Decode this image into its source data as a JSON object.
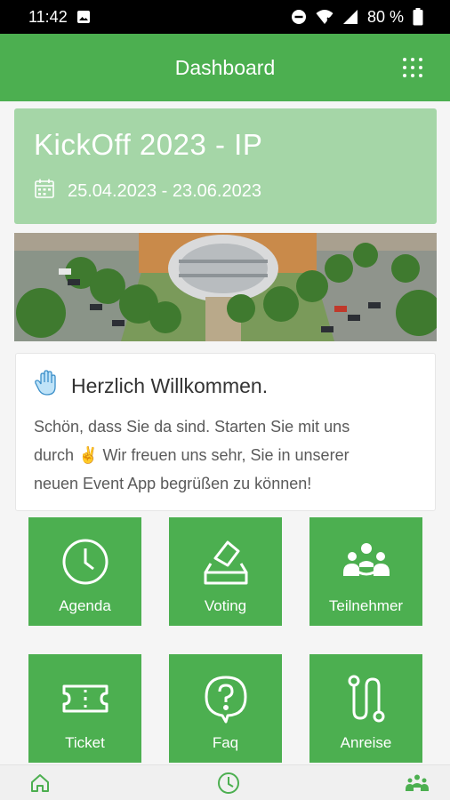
{
  "status_bar": {
    "time": "11:42",
    "battery": "80 %"
  },
  "app_bar": {
    "title": "Dashboard"
  },
  "event": {
    "name": "KickOff 2023 - IP",
    "dates": "25.04.2023 - 23.06.2023"
  },
  "welcome": {
    "title": "Herzlich Willkommen.",
    "line1": "Schön, dass Sie da sind. Starten Sie mit uns",
    "line2": "durch ✌ Wir freuen uns sehr, Sie in unserer",
    "line3": "neuen Event App begrüßen zu können!"
  },
  "tiles": [
    {
      "label": "Agenda",
      "icon": "clock-icon"
    },
    {
      "label": "Voting",
      "icon": "ballot-icon"
    },
    {
      "label": "Teilnehmer",
      "icon": "people-icon"
    },
    {
      "label": "Ticket",
      "icon": "ticket-icon"
    },
    {
      "label": "Faq",
      "icon": "question-bubble-icon"
    },
    {
      "label": "Anreise",
      "icon": "route-icon"
    }
  ],
  "bottom_nav": [
    {
      "icon": "home-icon"
    },
    {
      "icon": "clock-icon"
    },
    {
      "icon": "people-icon"
    }
  ],
  "colors": {
    "primary": "#4caf50",
    "event_card": "#a5d6a7",
    "background": "#f5f5f5"
  }
}
